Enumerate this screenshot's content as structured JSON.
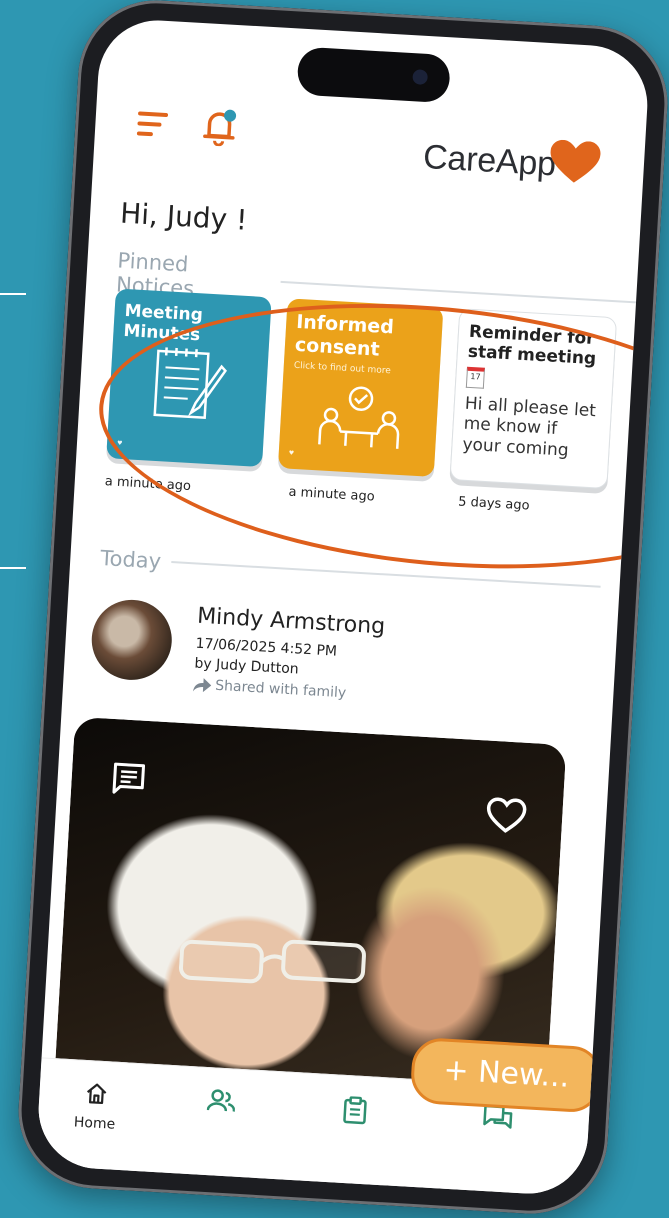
{
  "app": {
    "brand": "CareApp",
    "greeting": "Hi, Judy !"
  },
  "sections": {
    "pinned": "Pinned Notices",
    "today": "Today"
  },
  "pinned": [
    {
      "title": "Meeting Minutes",
      "time": "a minute ago"
    },
    {
      "title": "Informed consent",
      "subtitle": "Click to find out more",
      "time": "a minute ago"
    },
    {
      "title": "Reminder for staff meeting",
      "calendar": "17",
      "body": "Hi all please let me know if your coming",
      "time": "5 days ago"
    }
  ],
  "post": {
    "name": "Mindy Armstrong",
    "date": "17/06/2025 4:52 PM",
    "by": "by Judy  Dutton",
    "shared": "Shared with family"
  },
  "actions": {
    "new": "+ New..."
  },
  "nav": {
    "home": "Home"
  },
  "colors": {
    "background": "#2e97b2",
    "accent_orange": "#e0651c",
    "teal": "#2e97b2",
    "yellow": "#eba21a",
    "new_button": "#f3b65c"
  },
  "icons": [
    "menu-icon",
    "bell-icon",
    "heart-logo",
    "comment-icon",
    "heart-icon",
    "home-icon",
    "people-icon",
    "clipboard-icon",
    "chat-icon",
    "share-arrow-icon"
  ]
}
